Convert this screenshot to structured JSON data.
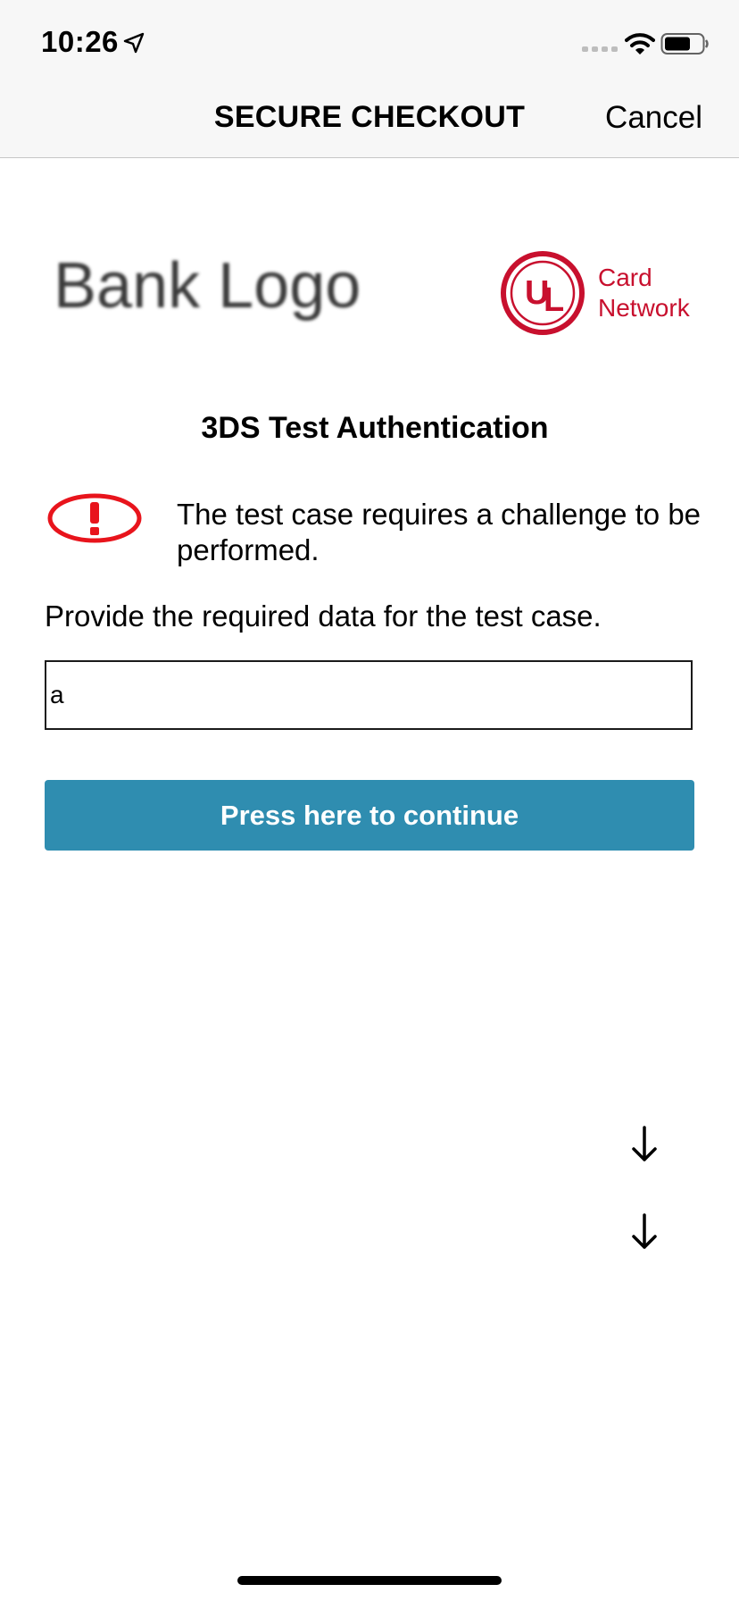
{
  "status_bar": {
    "time": "10:26",
    "icons": [
      "location-arrow-icon",
      "signal-icon",
      "wifi-icon",
      "battery-icon"
    ]
  },
  "nav": {
    "title": "SECURE CHECKOUT",
    "cancel_label": "Cancel"
  },
  "logos": {
    "bank_logo_text": "Bank Logo",
    "card_network_mark": "UL",
    "card_network_line1": "Card",
    "card_network_line2": "Network",
    "card_network_color": "#c8102e"
  },
  "content": {
    "heading": "3DS Test Authentication",
    "info_icon": "exclamation-alert-icon",
    "info_text": "The test case requires a challenge to be performed.",
    "instruction": "Provide the required data for the test case.",
    "input_value": "a",
    "continue_label": "Press here to continue",
    "continue_color": "#2f8db0",
    "alert_color": "#e8141c"
  },
  "scroll_icons": [
    "arrow-down-icon",
    "arrow-down-icon"
  ]
}
